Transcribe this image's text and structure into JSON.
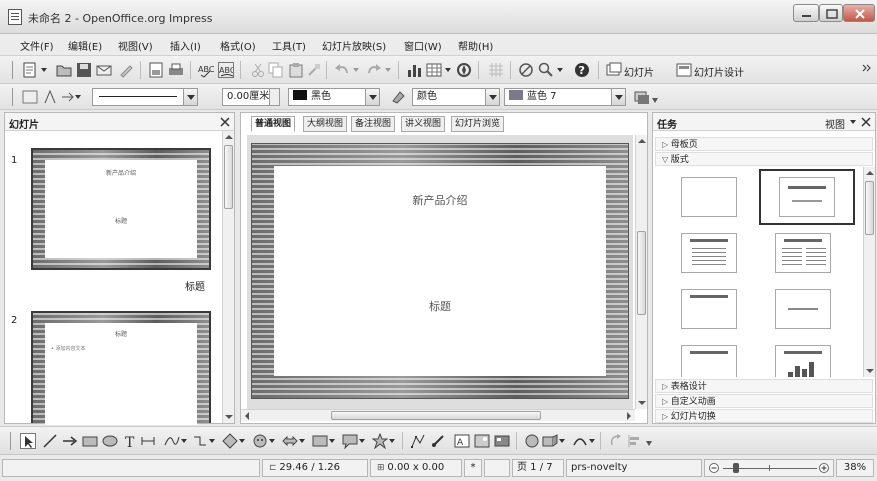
{
  "window": {
    "title": "未命名 2 - OpenOffice.org Impress"
  },
  "menu": {
    "items": [
      "文件(F)",
      "编辑(E)",
      "视图(V)",
      "插入(I)",
      "格式(O)",
      "工具(T)",
      "幻灯片放映(S)",
      "窗口(W)",
      "帮助(H)"
    ]
  },
  "toolbar_top": {
    "slide_button": "幻灯片",
    "slide_design_button": "幻灯片设计"
  },
  "toolbar_line": {
    "width_value": "0.00厘米",
    "line_color": "黑色",
    "area_style": "颜色",
    "fill_color": "蓝色 7",
    "line_color_swatch": "#111111",
    "fill_color_swatch": "#7a7a8a"
  },
  "slides_pane": {
    "title": "幻灯片",
    "slides": [
      {
        "number": "1",
        "heading": "新产品介绍",
        "subtitle": "标题",
        "caption": "标题"
      },
      {
        "number": "2",
        "heading": "标题",
        "bullet": "• 添加内容文本"
      }
    ]
  },
  "view_tabs": [
    "普通视图",
    "大纲视图",
    "备注视图",
    "讲义视图",
    "幻灯片浏览"
  ],
  "main_slide": {
    "heading": "新产品介绍",
    "subtitle": "标题"
  },
  "task_pane": {
    "title": "任务",
    "view_menu": "视图",
    "sections": {
      "master_pages": "母板页",
      "layouts": "版式",
      "table_design": "表格设计",
      "custom_animation": "自定义动画",
      "slide_transition": "幻灯片切换"
    }
  },
  "status": {
    "position": "29.46 / 1.26",
    "size": "0.00 x 0.00",
    "page": "页 1 / 7",
    "design": "prs-novelty",
    "zoom": "38%"
  }
}
